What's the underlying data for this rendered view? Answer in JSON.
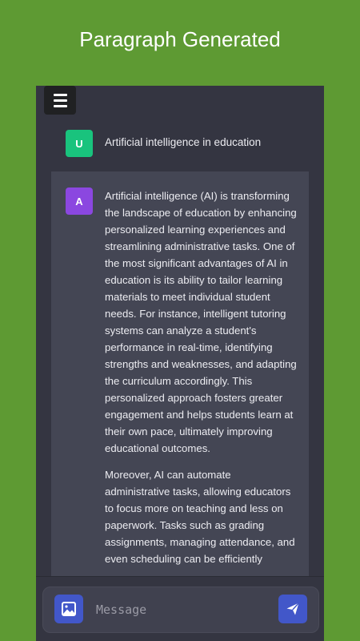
{
  "page": {
    "title": "Paragraph Generated"
  },
  "chat": {
    "user_avatar": "U",
    "user_message": "Artificial intelligence in education",
    "ai_avatar": "A",
    "ai_paragraphs": [
      "Artificial intelligence (AI) is transforming the landscape of education by enhancing personalized learning experiences and streamlining administrative tasks. One of the most significant advantages of AI in education is its ability to tailor learning materials to meet individual student needs. For instance, intelligent tutoring systems can analyze a student's performance in real-time, identifying strengths and weaknesses, and adapting the curriculum accordingly. This personalized approach fosters greater engagement and helps students learn at their own pace, ultimately improving educational outcomes.",
      "Moreover, AI can automate administrative tasks, allowing educators to focus more on teaching and less on paperwork. Tasks such as grading assignments, managing attendance, and even scheduling can be efficiently"
    ]
  },
  "composer": {
    "placeholder": "Message",
    "image_icon": "image-icon",
    "send_icon": "send-icon"
  },
  "colors": {
    "background": "#5e9a33",
    "chat_bg": "#343541",
    "ai_bubble": "#444654",
    "user_avatar": "#19c37d",
    "ai_avatar": "#8b47e0",
    "button_accent": "#4257c9"
  }
}
